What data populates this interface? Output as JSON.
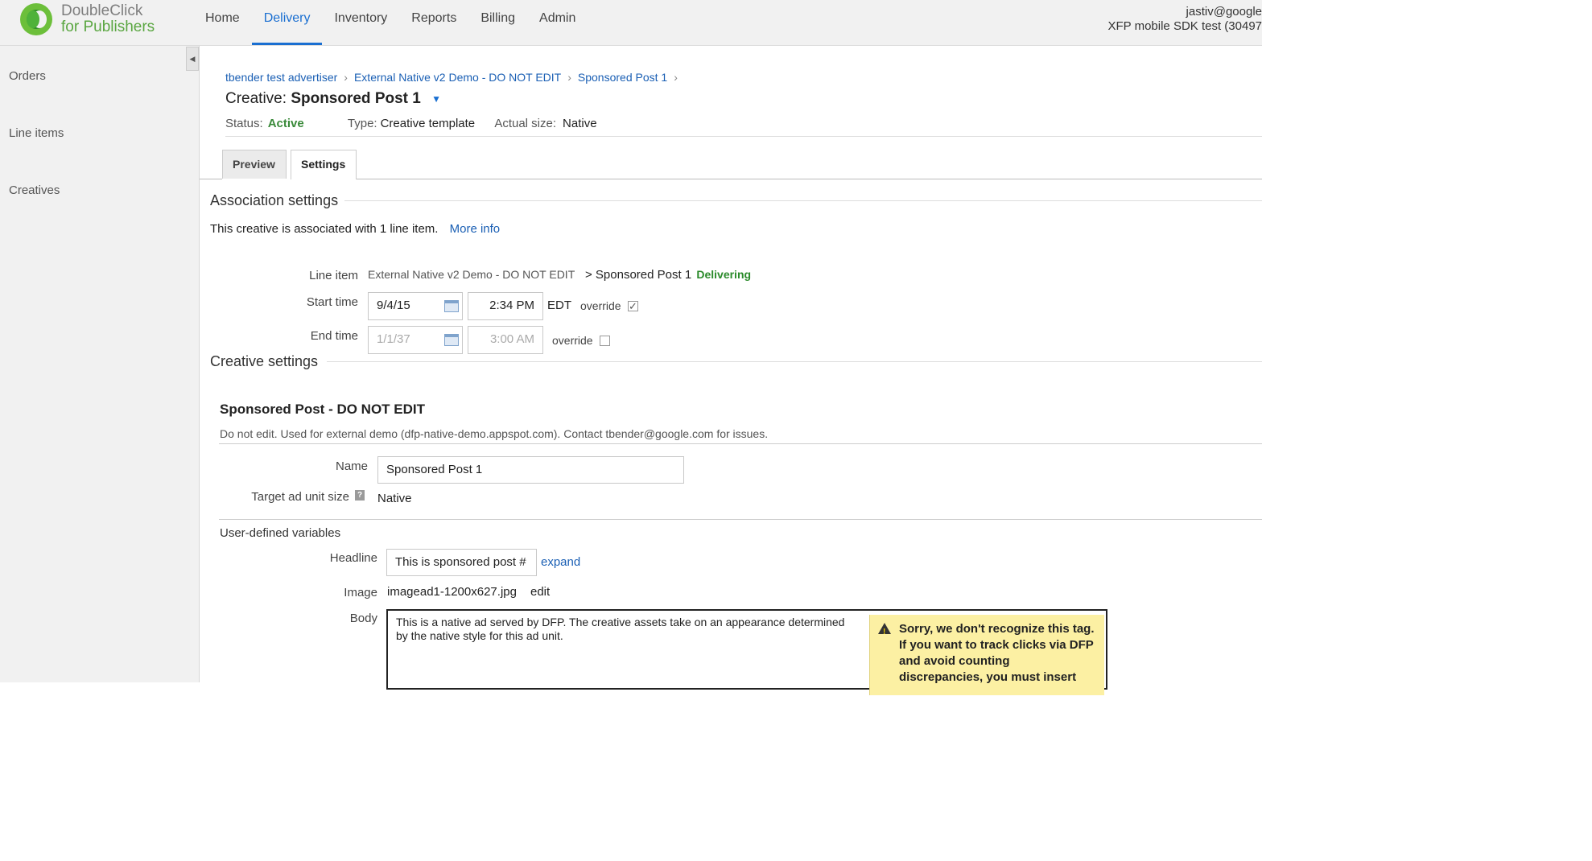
{
  "app": {
    "logo_line1": "DoubleClick",
    "logo_line2": "for Publishers"
  },
  "nav": [
    {
      "label": "Home"
    },
    {
      "label": "Delivery"
    },
    {
      "label": "Inventory"
    },
    {
      "label": "Reports"
    },
    {
      "label": "Billing"
    },
    {
      "label": "Admin"
    }
  ],
  "nav_active": "Delivery",
  "user": {
    "email": "jastiv@google",
    "network": "XFP mobile SDK test (30497"
  },
  "sidebar": {
    "items": [
      {
        "label": "Orders"
      },
      {
        "label": "Line items"
      },
      {
        "label": "Creatives"
      }
    ]
  },
  "breadcrumb": [
    "tbender test advertiser",
    "External Native v2 Demo - DO NOT EDIT",
    "Sponsored Post 1"
  ],
  "breadcrumb_sep": "›",
  "creative": {
    "title_prefix": "Creative:",
    "title_name": "Sponsored Post 1",
    "status_label": "Status:",
    "status_value": "Active",
    "type_label": "Type:",
    "type_value": "Creative template",
    "size_label": "Actual size:",
    "size_value": "Native"
  },
  "tabs": [
    {
      "label": "Preview"
    },
    {
      "label": "Settings"
    }
  ],
  "association": {
    "heading": "Association settings",
    "text": "This creative is associated with 1 line item.",
    "more_info": "More info",
    "line_item_label": "Line item",
    "line_item_order": "External Native v2 Demo - DO NOT EDIT",
    "line_item_name": "> Sponsored Post 1",
    "line_item_status": "Delivering",
    "start_label": "Start time",
    "start_date": "9/4/15",
    "start_time": "2:34 PM",
    "timezone": "EDT",
    "override_label": "override",
    "start_override": true,
    "end_label": "End time",
    "end_date": "1/1/37",
    "end_time": "3:00 AM",
    "end_override": false
  },
  "creative_settings": {
    "heading": "Creative settings",
    "template_name": "Sponsored Post - DO NOT EDIT",
    "template_desc": "Do not edit. Used for external demo (dfp-native-demo.appspot.com). Contact tbender@google.com for issues.",
    "name_label": "Name",
    "name_value": "Sponsored Post 1",
    "target_label": "Target ad unit size",
    "target_value": "Native",
    "udv_heading": "User-defined variables",
    "headline_label": "Headline",
    "headline_value": "This is sponsored post #",
    "expand": "expand",
    "image_label": "Image",
    "image_value": "imagead1-1200x627.jpg",
    "image_edit": "edit",
    "body_label": "Body",
    "body_value": "This is a native ad served by DFP. The creative assets take on an appearance determined by the native style for this ad unit.",
    "warning": "Sorry, we don't recognize this tag. If you want to track clicks via DFP and avoid counting discrepancies, you must insert"
  }
}
